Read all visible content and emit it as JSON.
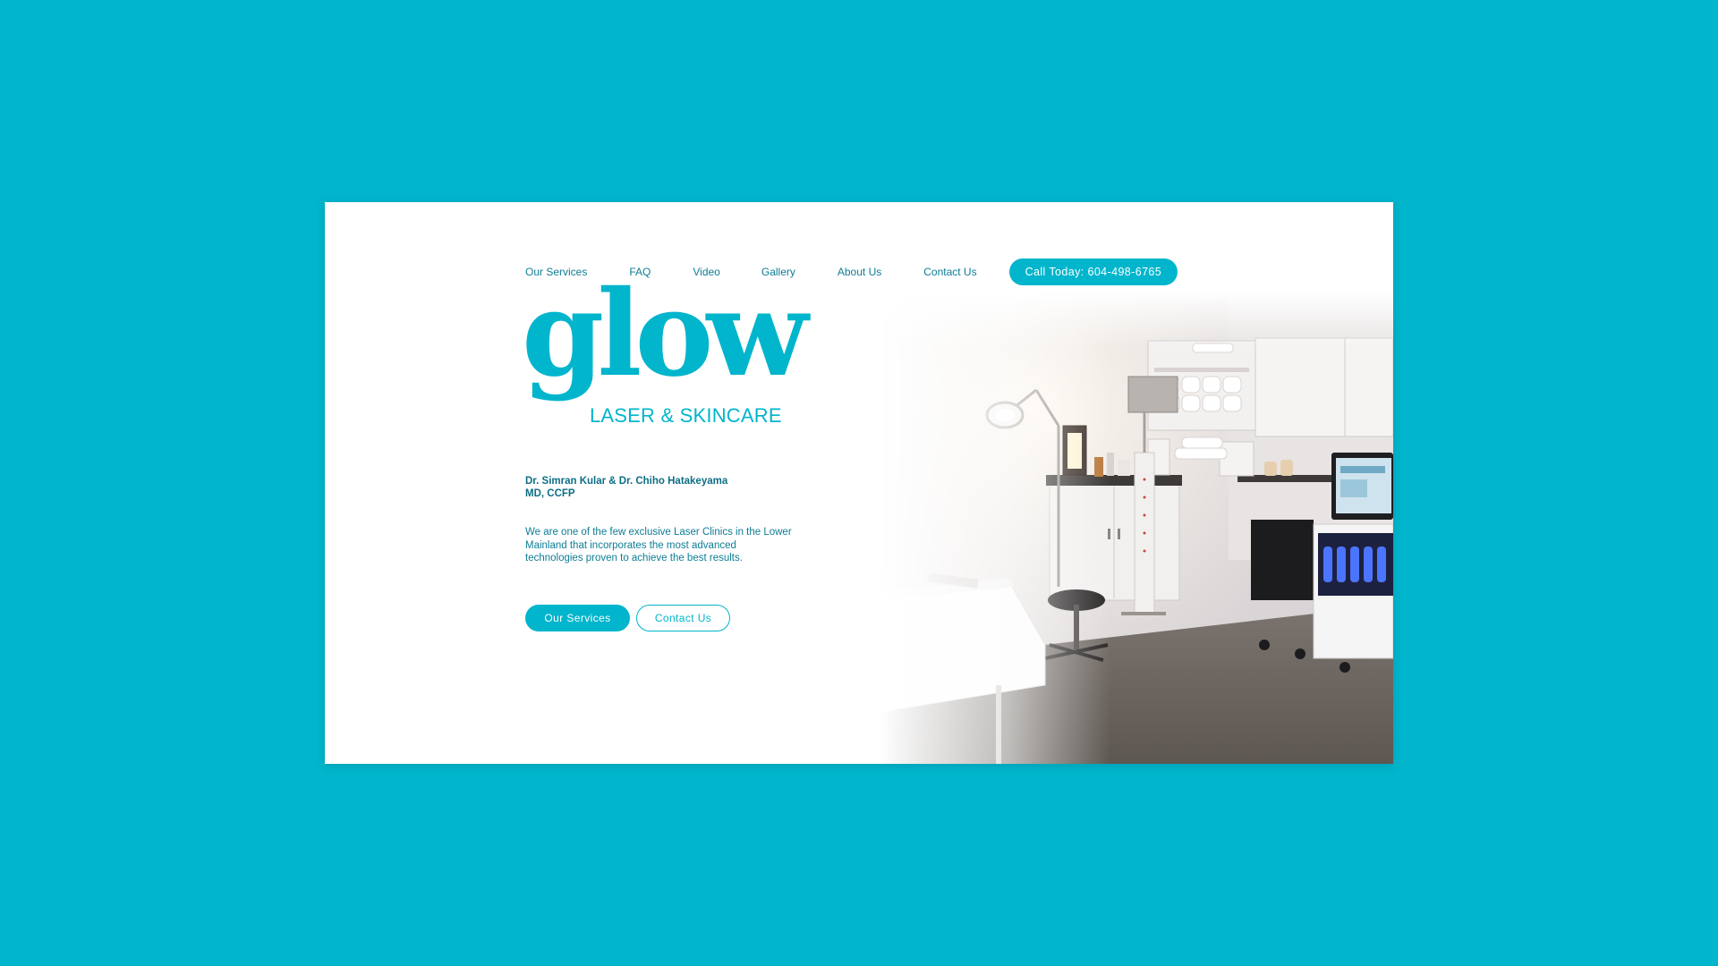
{
  "nav": {
    "items": [
      {
        "label": "Our Services"
      },
      {
        "label": "FAQ"
      },
      {
        "label": "Video"
      },
      {
        "label": "Gallery"
      },
      {
        "label": "About Us"
      },
      {
        "label": "Contact Us"
      }
    ],
    "call_label": "Call Today: 604-498-6765"
  },
  "logo": {
    "word": "glow",
    "subtitle": "LASER & SKINCARE"
  },
  "hero": {
    "doctors_line1": "Dr. Simran Kular & Dr. Chiho Hatakeyama",
    "doctors_line2": "MD, CCFP",
    "description": "We are one of the few exclusive Laser Clinics in the Lower Mainland that incorporates the most advanced technologies proven to achieve the best results.",
    "primary_button": "Our Services",
    "secondary_button": "Contact Us"
  },
  "colors": {
    "accent": "#00b5cc",
    "text_dark": "#0d6e86",
    "page_background": "#00b5cc"
  },
  "icons": {
    "photo": "treatment-room-photo"
  }
}
